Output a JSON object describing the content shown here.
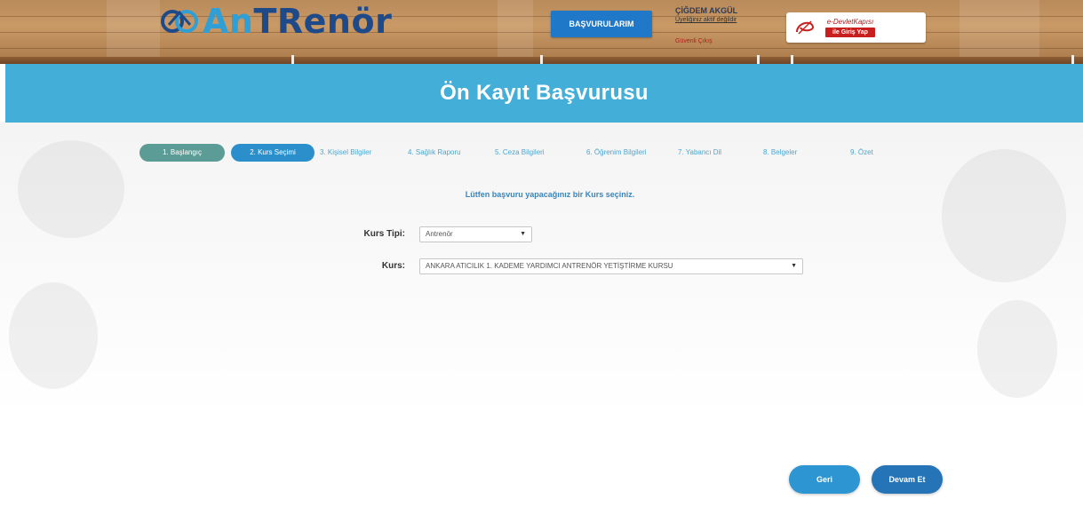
{
  "header": {
    "logo": {
      "prefix": "An",
      "suffix": "TRenör"
    },
    "applications_button": "BAŞVURULARIM",
    "user": {
      "name": "ÇİĞDEM AKGÜL",
      "detail": "Üyeliğiniz aktif değildir",
      "logout": "Güvenli Çıkış"
    },
    "edevlet": {
      "title": "e-DevletKapısı",
      "login": "ile Giriş Yap"
    }
  },
  "page_title": "Ön Kayıt Başvurusu",
  "steps": [
    {
      "label": "1. Başlangıç",
      "state": "done"
    },
    {
      "label": "2. Kurs Seçimi",
      "state": "active"
    },
    {
      "label": "3. Kişisel Bilgiler",
      "state": "pending"
    },
    {
      "label": "4. Sağlık Raporu",
      "state": "pending"
    },
    {
      "label": "5. Ceza Bilgileri",
      "state": "pending"
    },
    {
      "label": "6. Öğrenim Bilgileri",
      "state": "pending"
    },
    {
      "label": "7. Yabancı Dil",
      "state": "pending"
    },
    {
      "label": "8. Belgeler",
      "state": "pending"
    },
    {
      "label": "9. Özet",
      "state": "pending"
    }
  ],
  "instruction": "Lütfen başvuru yapacağınız bir Kurs seçiniz.",
  "form": {
    "course_type_label": "Kurs Tipi:",
    "course_type_value": "Antrenör",
    "course_label": "Kurs:",
    "course_value": "ANKARA ATICILIK 1. KADEME YARDIMCI ANTRENÖR YETİŞTİRME KURSU"
  },
  "buttons": {
    "back": "Geri",
    "next": "Devam Et"
  },
  "colors": {
    "title_band": "#43aed8",
    "step_done": "#5c9c96",
    "step_active": "#2b8fcc",
    "button": "#2d95d2"
  }
}
